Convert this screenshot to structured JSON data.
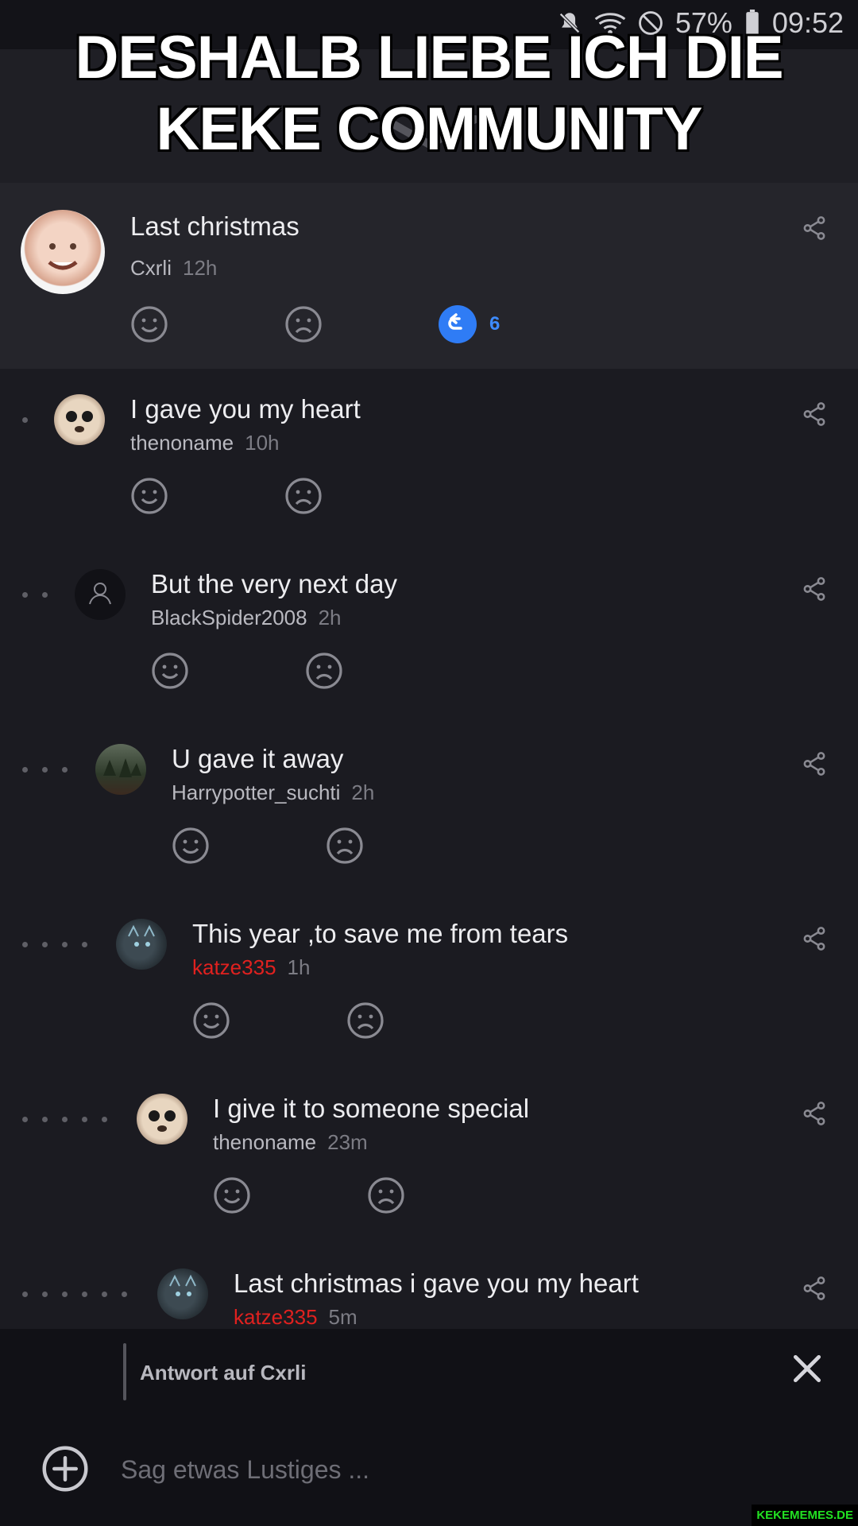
{
  "meme_caption": "DESHALB LIEBE ICH DIE KEKE COMMUNITY",
  "status": {
    "battery": "57%",
    "time": "09:52"
  },
  "root_post": {
    "title": "Last christmas",
    "author": "Cxrli",
    "time": "12h",
    "reply_count": "6"
  },
  "comments": [
    {
      "title": "I gave you my heart",
      "author": "thenoname",
      "time": "10h",
      "depth": 1
    },
    {
      "title": "But the very next day",
      "author": "BlackSpider2008",
      "time": "2h",
      "depth": 2
    },
    {
      "title": "U gave it away",
      "author": "Harrypotter_suchti",
      "time": "2h",
      "depth": 3
    },
    {
      "title": "This year ,to save me from tears",
      "author": "katze335",
      "time": "1h",
      "depth": 4
    },
    {
      "title": "I give it to someone special",
      "author": "thenoname",
      "time": "23m",
      "depth": 5
    },
    {
      "title": "Last christmas i gave you my heart",
      "author": "katze335",
      "time": "5m",
      "depth": 6
    }
  ],
  "reply_bar": {
    "label": "Antwort auf Cxrli",
    "placeholder": "Sag etwas Lustiges ..."
  },
  "watermark": "KEKEMEMES.DE",
  "colors": {
    "background": "#1b1b21",
    "accent": "#2f7cf5",
    "highlight_author": "#e0211f"
  }
}
